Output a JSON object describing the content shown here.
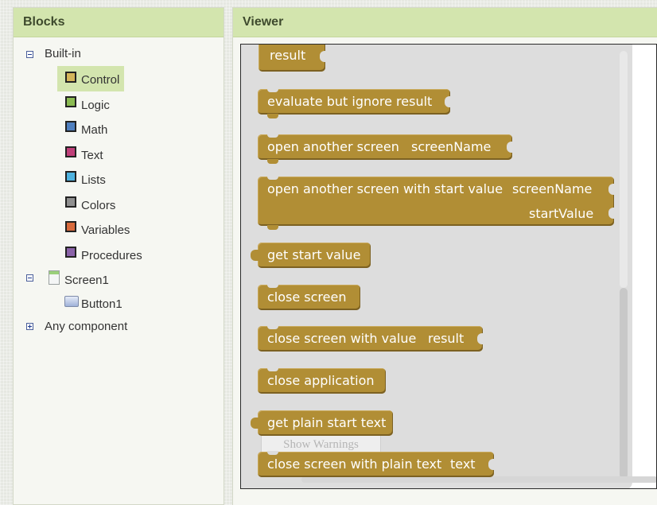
{
  "blocks_panel": {
    "title": "Blocks",
    "builtin_label": "Built-in",
    "categories": [
      {
        "label": "Control",
        "color": "#d4b55a",
        "selected": true
      },
      {
        "label": "Logic",
        "color": "#8bbb52"
      },
      {
        "label": "Math",
        "color": "#4f7fbf"
      },
      {
        "label": "Text",
        "color": "#c0407a"
      },
      {
        "label": "Lists",
        "color": "#4fb3e0"
      },
      {
        "label": "Colors",
        "color": "#8f8f8f"
      },
      {
        "label": "Variables",
        "color": "#d86a3c"
      },
      {
        "label": "Procedures",
        "color": "#8a62a8"
      }
    ],
    "screen_label": "Screen1",
    "button_label": "Button1",
    "any_component_label": "Any component"
  },
  "viewer": {
    "title": "Viewer",
    "show_warnings_label": "Show Warnings",
    "blocks": [
      {
        "label": "result"
      },
      {
        "label": "evaluate but ignore result"
      },
      {
        "label": "open another screen",
        "param": "screenName"
      },
      {
        "label": "open another screen with start value",
        "param": "screenName",
        "param2": "startValue"
      },
      {
        "label": "get start value"
      },
      {
        "label": "close screen"
      },
      {
        "label": "close screen with value",
        "param": "result"
      },
      {
        "label": "close application"
      },
      {
        "label": "get plain start text"
      },
      {
        "label": "close screen with plain text",
        "param": "text"
      }
    ]
  },
  "colors": {
    "block": "#b18e35",
    "header": "#d3e5ae"
  }
}
